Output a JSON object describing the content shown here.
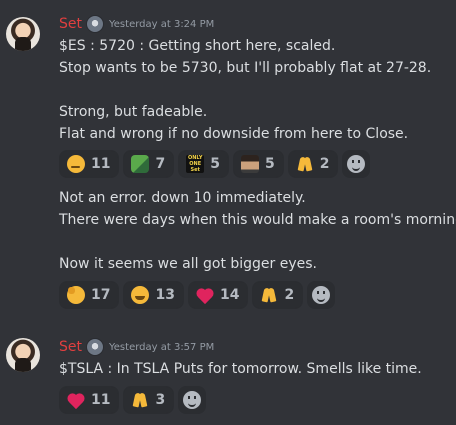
{
  "messages": [
    {
      "username": "Set",
      "timestamp": "Yesterday at 3:24 PM",
      "lines": [
        "$ES : 5720 : Getting short here, scaled.",
        "Stop wants to be 5730, but I'll probably flat at 27-28.",
        "",
        "Strong, but fadeable.",
        "Flat and wrong if no downside from here to Close."
      ],
      "reactions": [
        {
          "icon": "thinking-face-icon",
          "count": "11"
        },
        {
          "icon": "pepe-icon",
          "count": "7"
        },
        {
          "icon": "only-one-icon",
          "label": "ONLY ONE Set",
          "count": "5"
        },
        {
          "icon": "person-photo-icon",
          "count": "5"
        },
        {
          "icon": "folded-hands-icon",
          "count": "2"
        }
      ],
      "lines2": [
        "Not an error. down 10 immediately.",
        "There were days when this would make a room's morning.",
        "",
        "Now it seems we all got bigger eyes."
      ],
      "reactions2": [
        {
          "icon": "saluting-face-icon",
          "count": "17"
        },
        {
          "icon": "laughing-face-icon",
          "count": "13"
        },
        {
          "icon": "heart-icon",
          "count": "14"
        },
        {
          "icon": "folded-hands-icon",
          "count": "2"
        }
      ]
    },
    {
      "username": "Set",
      "timestamp": "Yesterday at 3:57 PM",
      "lines": [
        "$TSLA : In TSLA Puts for tomorrow. Smells like time."
      ],
      "reactions": [
        {
          "icon": "heart-icon",
          "count": "11"
        },
        {
          "icon": "folded-hands-icon",
          "count": "3"
        }
      ]
    }
  ],
  "colors": {
    "background": "#313338",
    "username": "#e13f3f",
    "text": "#dbdee1",
    "timestamp": "#949ba4",
    "reaction_bg": "#2b2d31"
  }
}
